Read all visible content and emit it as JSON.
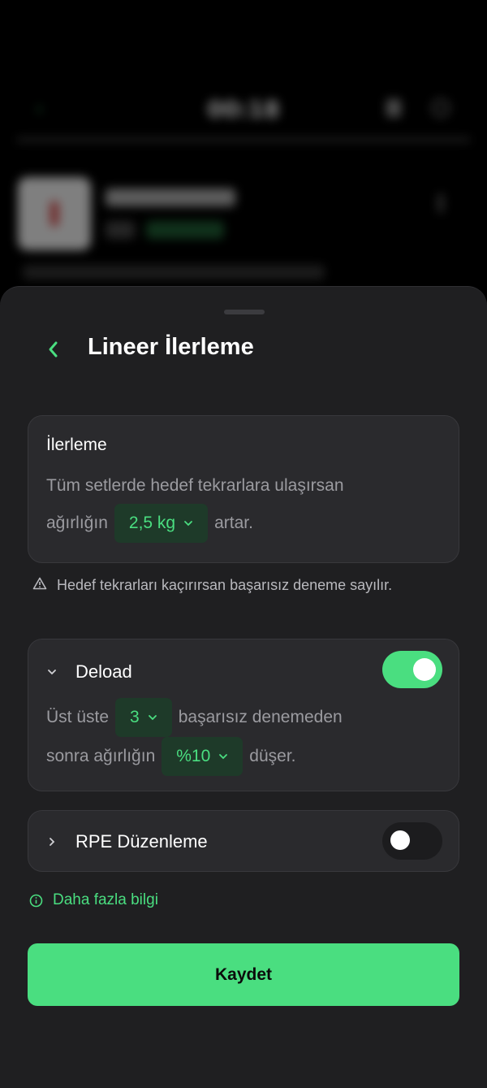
{
  "background": {
    "timer": "00:18"
  },
  "sheet": {
    "title": "Lineer İlerleme",
    "progression": {
      "heading": "İlerleme",
      "line1": "Tüm setlerde hedef tekrarlara ulaşırsan",
      "line2_before": "ağırlığın",
      "weight_value": "2,5 kg",
      "line2_after": "artar."
    },
    "warning": "Hedef tekrarları kaçırırsan başarısız deneme sayılır.",
    "deload": {
      "label": "Deload",
      "enabled": true,
      "line1_before": "Üst üste",
      "attempts_value": "3",
      "line1_after": "başarısız denemeden",
      "line2_before": "sonra ağırlığın",
      "percent_value": "%10",
      "line2_after": "düşer."
    },
    "rpe": {
      "label": "RPE Düzenleme",
      "enabled": false
    },
    "more_info": "Daha fazla bilgi",
    "save_label": "Kaydet"
  },
  "colors": {
    "accent": "#4ade80",
    "sheet_bg": "#1f1f21",
    "card_bg": "#2a2a2d",
    "chip_bg": "#1e3a29"
  },
  "icons": [
    "chevron-left-icon",
    "warning-triangle-icon",
    "chevron-down-icon",
    "chevron-right-icon",
    "info-circle-icon"
  ]
}
